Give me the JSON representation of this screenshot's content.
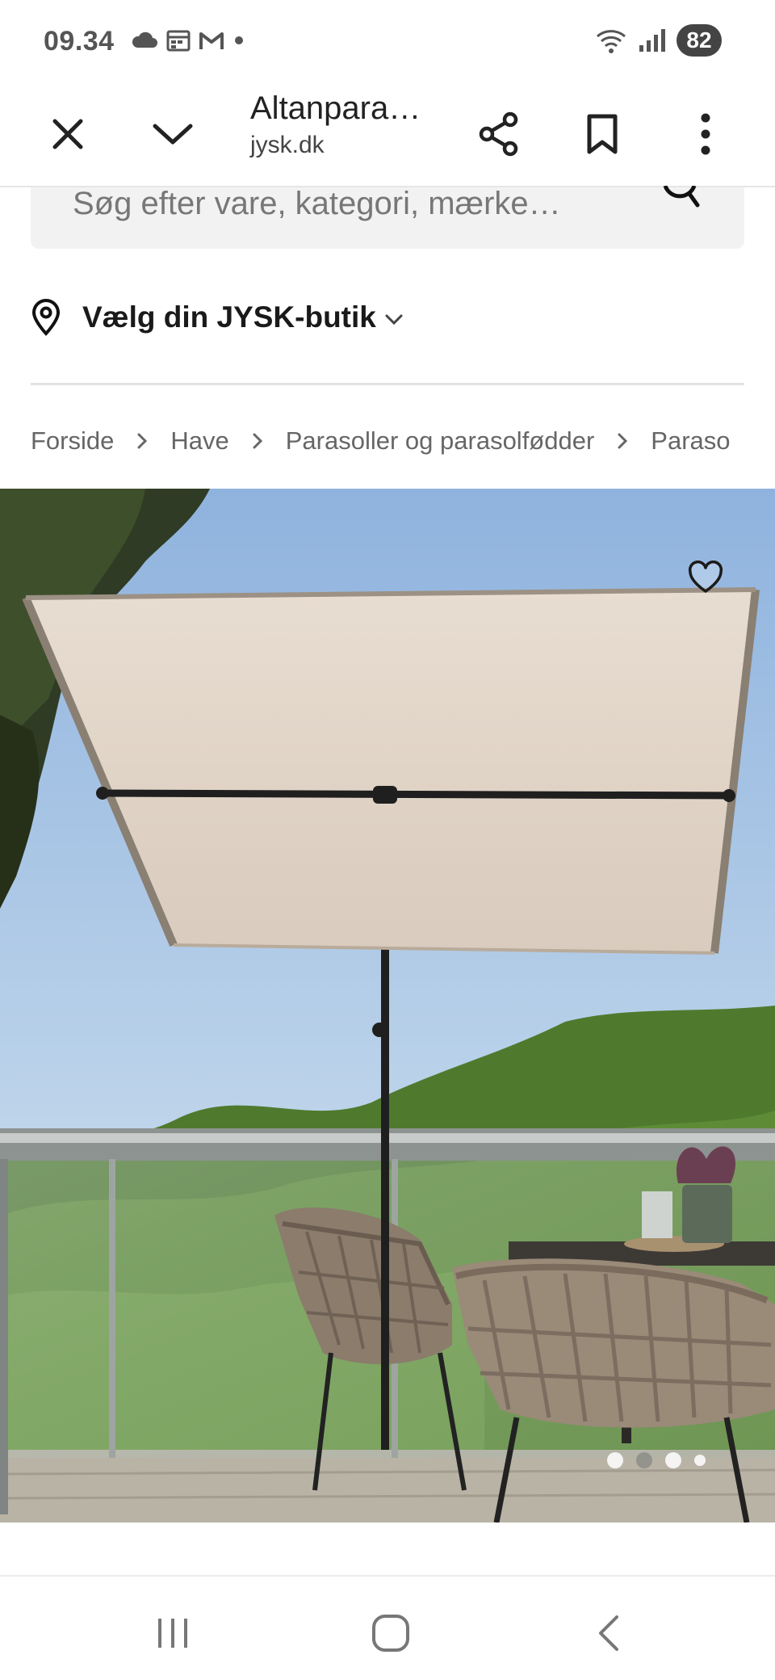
{
  "status_bar": {
    "time": "09.34",
    "icons_left": [
      "cloud-icon",
      "calendar-icon",
      "gmail-icon",
      "dot-icon"
    ],
    "icons_right": [
      "wifi-icon",
      "signal-icon"
    ],
    "battery": "82"
  },
  "browser": {
    "tab_title": "Altanpara…",
    "url": "jysk.dk",
    "close_icon": "close-icon",
    "collapse_icon": "chevron-down-icon",
    "share_icon": "share-icon",
    "bookmark_icon": "bookmark-icon",
    "menu_icon": "more-vert-icon"
  },
  "search": {
    "placeholder": "Søg efter vare, kategori, mærke…",
    "icon": "search-icon"
  },
  "store": {
    "label": "Vælg din JYSK-butik",
    "icon": "location-pin-icon"
  },
  "breadcrumb": {
    "items": [
      "Forside",
      "Have",
      "Parasoller og parasolfødder",
      "Paraso"
    ]
  },
  "product": {
    "favorite_icon": "heart-icon",
    "carousel": {
      "total": 4,
      "active_index": 1
    }
  },
  "nav": {
    "recents_icon": "recents-icon",
    "home_icon": "home-icon",
    "back_icon": "back-icon"
  }
}
